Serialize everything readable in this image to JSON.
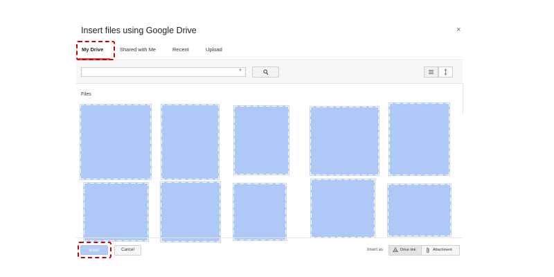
{
  "dialog": {
    "title": "Insert files using Google Drive",
    "close_label": "×"
  },
  "tabs": [
    {
      "label": "My Drive",
      "active": true
    },
    {
      "label": "Shared with Me",
      "active": false
    },
    {
      "label": "Recent",
      "active": false
    },
    {
      "label": "Upload",
      "active": false
    }
  ],
  "toolbar": {
    "search_value": "",
    "view_icons": [
      "list-view-icon",
      "sort-icon"
    ]
  },
  "files": {
    "label": "Files",
    "tile_count": 10
  },
  "footer": {
    "insert_label": "Insert",
    "cancel_label": "Cancel",
    "insert_as_label": "Insert as",
    "drive_link_label": "Drive link",
    "attachment_label": "Attachment"
  },
  "colors": {
    "highlight": "#cc0000",
    "tile_fill": "#aec9f7",
    "insert_button": "#b4cbf5",
    "active_tab_bar": "#dd4b39"
  }
}
